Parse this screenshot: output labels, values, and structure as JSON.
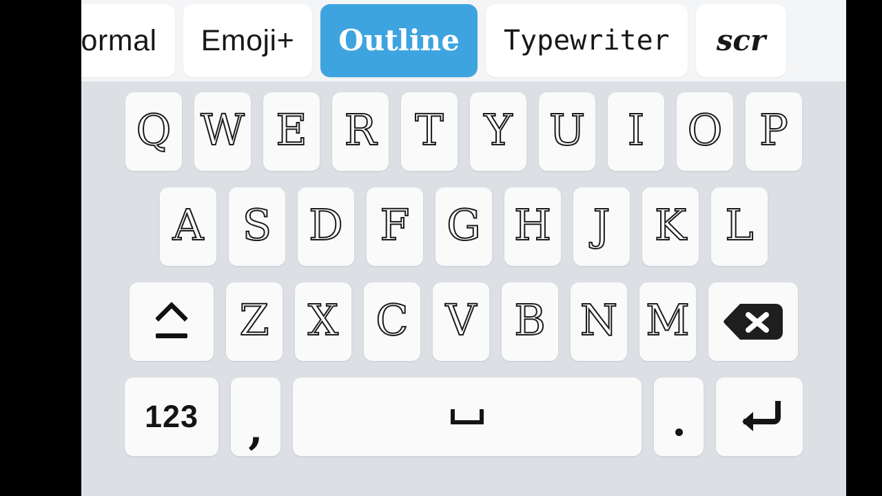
{
  "theme": {
    "letterbox_color": "#000000",
    "keyboard_background": "#dcdfe4",
    "tabbar_background": "#f4f5f7",
    "key_background": "#fafafb",
    "active_tab_background": "#3ea4e0",
    "active_tab_text": "#ffffff",
    "glyph_color": "#1a1a1a"
  },
  "fontbar": {
    "name": "font-style-tabs",
    "tabs": [
      {
        "id": "normal",
        "label": "Normal",
        "active": false,
        "clipped": true
      },
      {
        "id": "emoji-plus",
        "label": "Emoji+",
        "active": false,
        "clipped": false
      },
      {
        "id": "outline",
        "label": "Outline",
        "active": true,
        "clipped": false
      },
      {
        "id": "typewriter",
        "label": "Typewriter",
        "active": false,
        "clipped": false
      },
      {
        "id": "script",
        "label": "scr",
        "active": false,
        "clipped": true
      }
    ]
  },
  "keyboard": {
    "layout": "QWERTY",
    "style": "outline",
    "rows": [
      {
        "id": "row1",
        "keys": [
          {
            "label": "Q",
            "name": "key-q"
          },
          {
            "label": "W",
            "name": "key-w"
          },
          {
            "label": "E",
            "name": "key-e"
          },
          {
            "label": "R",
            "name": "key-r"
          },
          {
            "label": "T",
            "name": "key-t"
          },
          {
            "label": "Y",
            "name": "key-y"
          },
          {
            "label": "U",
            "name": "key-u"
          },
          {
            "label": "I",
            "name": "key-i"
          },
          {
            "label": "O",
            "name": "key-o"
          },
          {
            "label": "P",
            "name": "key-p"
          }
        ]
      },
      {
        "id": "row2",
        "keys": [
          {
            "label": "A",
            "name": "key-a"
          },
          {
            "label": "S",
            "name": "key-s"
          },
          {
            "label": "D",
            "name": "key-d"
          },
          {
            "label": "F",
            "name": "key-f"
          },
          {
            "label": "G",
            "name": "key-g"
          },
          {
            "label": "H",
            "name": "key-h"
          },
          {
            "label": "J",
            "name": "key-j"
          },
          {
            "label": "K",
            "name": "key-k"
          },
          {
            "label": "L",
            "name": "key-l"
          }
        ]
      },
      {
        "id": "row3",
        "keys": [
          {
            "label": "",
            "name": "key-shift",
            "icon": "shift-icon"
          },
          {
            "label": "Z",
            "name": "key-z"
          },
          {
            "label": "X",
            "name": "key-x"
          },
          {
            "label": "C",
            "name": "key-c"
          },
          {
            "label": "V",
            "name": "key-v"
          },
          {
            "label": "B",
            "name": "key-b"
          },
          {
            "label": "N",
            "name": "key-n"
          },
          {
            "label": "M",
            "name": "key-m"
          },
          {
            "label": "",
            "name": "key-backspace",
            "icon": "backspace-icon"
          }
        ]
      },
      {
        "id": "row4",
        "keys": [
          {
            "label": "123",
            "name": "key-numeric-switch"
          },
          {
            "label": ",",
            "name": "key-comma"
          },
          {
            "label": "",
            "name": "key-space",
            "icon": "space-icon"
          },
          {
            "label": ".",
            "name": "key-period"
          },
          {
            "label": "",
            "name": "key-enter",
            "icon": "enter-icon"
          }
        ]
      }
    ]
  }
}
